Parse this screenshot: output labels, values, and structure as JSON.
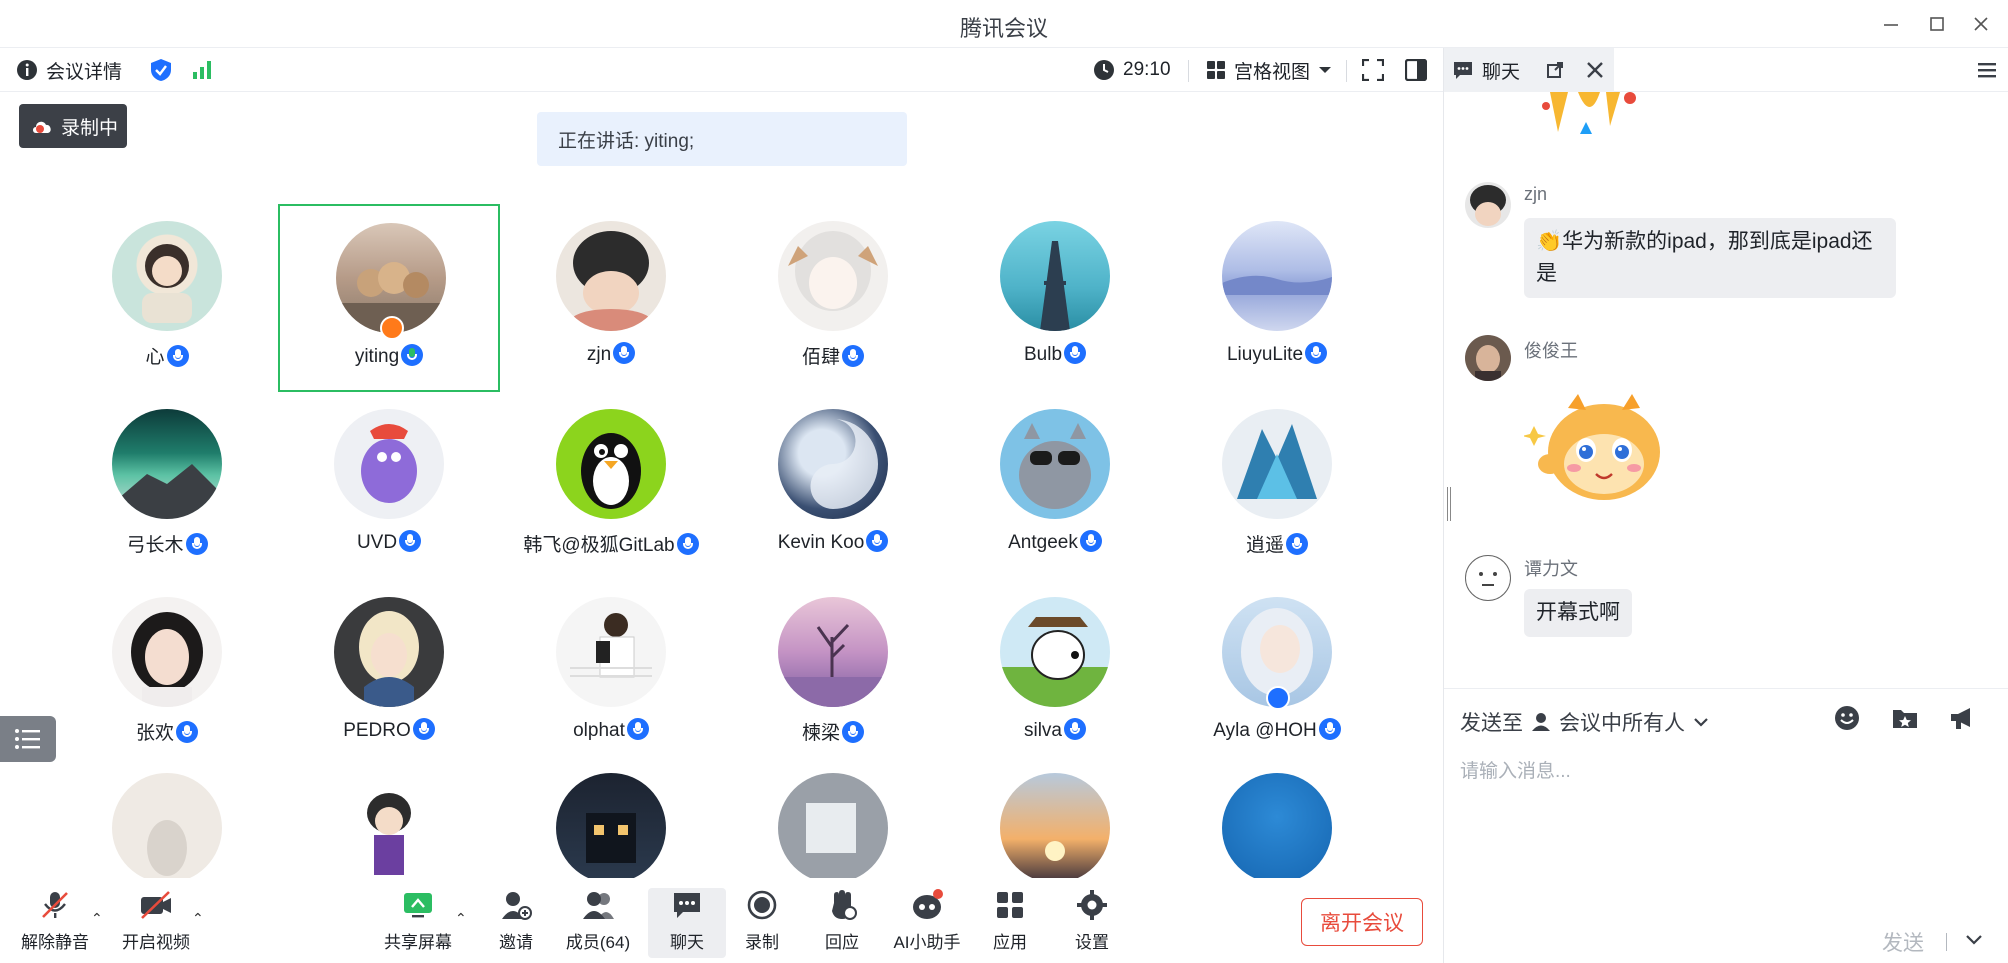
{
  "window": {
    "title": "腾讯会议"
  },
  "meeting_toolbar": {
    "details_label": "会议详情",
    "timer": "29:10",
    "view_label": "宫格视图"
  },
  "recording_badge": "录制中",
  "speaking_banner": "正在讲话: yiting;",
  "participants": [
    {
      "name": "心",
      "active": false
    },
    {
      "name": "yiting",
      "active": true
    },
    {
      "name": "zjn",
      "active": false
    },
    {
      "name": "佰肆",
      "active": false
    },
    {
      "name": "Bulb",
      "active": false
    },
    {
      "name": "LiuyuLite",
      "active": false
    },
    {
      "name": "弓长木",
      "active": false
    },
    {
      "name": "UVD",
      "active": false
    },
    {
      "name": "韩飞@极狐GitLab",
      "active": false
    },
    {
      "name": "Kevin Koo",
      "active": false
    },
    {
      "name": "Antgeek",
      "active": false
    },
    {
      "name": "逍遥",
      "active": false
    },
    {
      "name": "张欢",
      "active": false
    },
    {
      "name": "PEDRO",
      "active": false
    },
    {
      "name": "olphat",
      "active": false
    },
    {
      "name": "楝梁",
      "active": false
    },
    {
      "name": "silva",
      "active": false
    },
    {
      "name": "Ayla @HOH",
      "active": false
    },
    {
      "name": "",
      "active": false
    },
    {
      "name": "",
      "active": false
    },
    {
      "name": "",
      "active": false
    },
    {
      "name": "",
      "active": false
    },
    {
      "name": "",
      "active": false
    },
    {
      "name": "",
      "active": false
    }
  ],
  "bottom_toolbar": {
    "unmute": "解除静音",
    "start_video": "开启视频",
    "share_screen": "共享屏幕",
    "invite": "邀请",
    "members": "成员(64)",
    "chat": "聊天",
    "record": "录制",
    "react": "回应",
    "ai_assistant": "AI小助手",
    "apps": "应用",
    "settings": "设置",
    "leave": "离开会议"
  },
  "chat": {
    "tab_label": "聊天",
    "messages": [
      {
        "sender": "zjn",
        "text": "👏华为新款的ipad，那到底是ipad还是"
      },
      {
        "sender": "俊俊王",
        "text": ""
      },
      {
        "sender": "谭力文",
        "text": "开幕式啊"
      }
    ],
    "send_to_label": "发送至",
    "recipient": "会议中所有人",
    "input_placeholder": "请输入消息...",
    "send_label": "发送"
  },
  "colors": {
    "accent": "#1e6fff",
    "active_speaker_border": "#2bbd62",
    "leave": "#e84b3c"
  }
}
